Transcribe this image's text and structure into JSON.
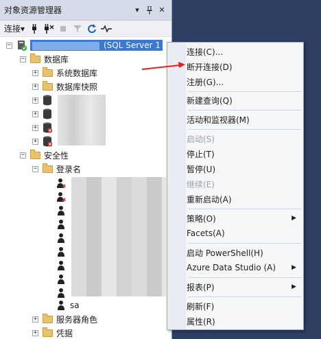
{
  "panel": {
    "title": "对象资源管理器",
    "pin": "▾",
    "autohide": "⊓",
    "close": "✕",
    "toolbar_connect": "连接▾"
  },
  "tree": {
    "server_label": "(SQL Server 1",
    "databases": "数据库",
    "system_databases": "系统数据库",
    "snapshots": "数据库快照",
    "security": "安全性",
    "logins": "登录名",
    "sa": "sa",
    "server_roles": "服务器角色",
    "credentials": "凭据"
  },
  "menu": {
    "items": [
      {
        "label": "连接(C)...",
        "enabled": true
      },
      {
        "label": "断开连接(D)",
        "enabled": true
      },
      {
        "label": "注册(G)...",
        "enabled": true
      },
      {
        "label": "新建查询(Q)",
        "enabled": true
      },
      {
        "label": "活动和监视器(M)",
        "enabled": true
      },
      {
        "label": "启动(S)",
        "enabled": false
      },
      {
        "label": "停止(T)",
        "enabled": true
      },
      {
        "label": "暂停(U)",
        "enabled": true
      },
      {
        "label": "继续(E)",
        "enabled": false
      },
      {
        "label": "重新启动(A)",
        "enabled": true
      },
      {
        "label": "策略(O)",
        "enabled": true,
        "submenu": true
      },
      {
        "label": "Facets(A)",
        "enabled": true
      },
      {
        "label": "启动 PowerShell(H)",
        "enabled": true
      },
      {
        "label": "Azure Data Studio (A)",
        "enabled": true,
        "submenu": true
      },
      {
        "label": "报表(P)",
        "enabled": true,
        "submenu": true
      },
      {
        "label": "刷新(F)",
        "enabled": true
      },
      {
        "label": "属性(R)",
        "enabled": true
      }
    ]
  },
  "colors": {
    "selection": "#3a78d4",
    "annotation_arrow": "#e02020"
  }
}
